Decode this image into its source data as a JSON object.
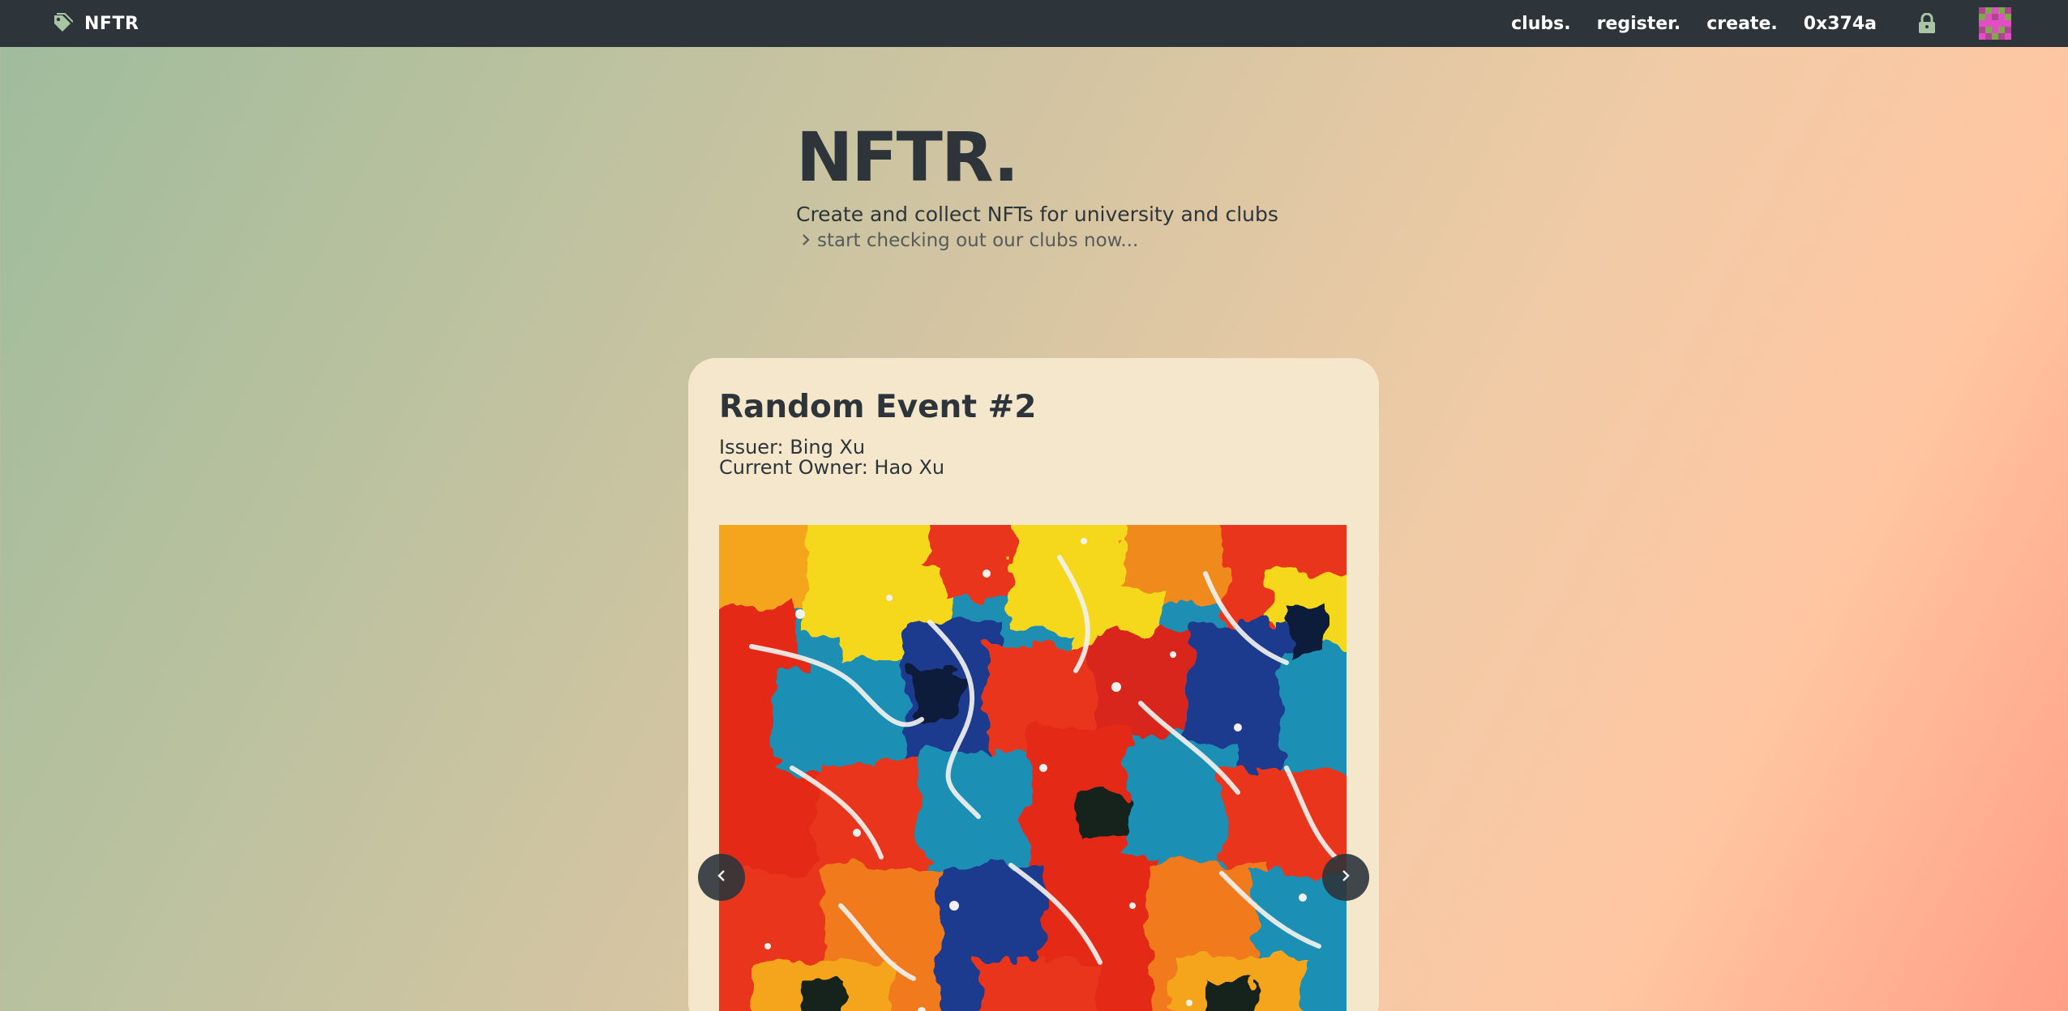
{
  "navbar": {
    "brand_icon": "tag-icon",
    "brand": "NFTR",
    "links": [
      "clubs.",
      "register.",
      "create."
    ],
    "account": "0x374a",
    "lock_icon": "lock-icon",
    "avatar_icon": "identicon-avatar"
  },
  "hero": {
    "title": "NFTR.",
    "subtitle": "Create and collect NFTs for university and clubs",
    "link_icon": "chevron-right-icon",
    "link": "start checking out our clubs now..."
  },
  "card": {
    "title": "Random Event #2",
    "issuer": "Issuer: Bing Xu",
    "owner": "Current Owner: Hao Xu",
    "image": "abstract-paint-artwork",
    "prev_icon": "chevron-left-icon",
    "next_icon": "chevron-right-icon"
  },
  "colors": {
    "navbar": "#2d353b",
    "card": "#f4e7cc",
    "text_dark": "#2d353b",
    "brand_icon": "#a8c6a4"
  }
}
